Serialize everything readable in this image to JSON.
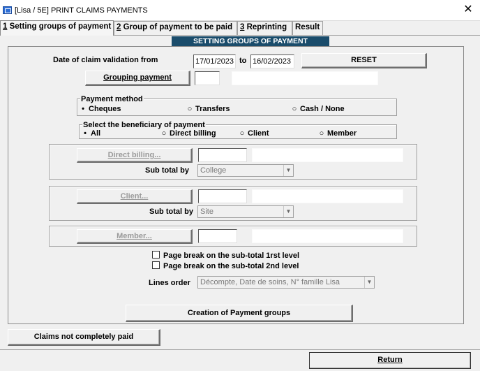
{
  "window": {
    "title": "[Lisa / 5E] PRINT CLAIMS PAYMENTS",
    "close": "✕"
  },
  "tabs": [
    {
      "num": "1",
      "label": " Setting groups of payment"
    },
    {
      "num": "2",
      "label": " Group of payment to be paid"
    },
    {
      "num": "3",
      "label": " Reprinting"
    },
    {
      "num": "",
      "label": "Result"
    }
  ],
  "section_header": "SETTING GROUPS OF PAYMENT",
  "date_range": {
    "label": "Date of claim validation from",
    "from": "17/01/2023",
    "to_label": "to",
    "to": "16/02/2023",
    "reset_label": "RESET"
  },
  "grouping_payment": {
    "button": "Grouping payment",
    "code": "",
    "desc": ""
  },
  "payment_method": {
    "title": "Payment method",
    "options": [
      "Cheques",
      "Transfers",
      "Cash / None"
    ],
    "selected": "Cheques"
  },
  "beneficiary": {
    "title": "Select the beneficiary of payment",
    "options": [
      "All",
      "Direct billing",
      "Client",
      "Member"
    ],
    "selected": "All"
  },
  "direct_billing": {
    "button": "Direct billing...",
    "subtotal_label": "Sub total by",
    "subtotal_value": "College"
  },
  "client": {
    "button": "Client...",
    "subtotal_label": "Sub total by",
    "subtotal_value": "Site"
  },
  "member": {
    "button": "Member..."
  },
  "checkboxes": [
    "Page break on the sub-total 1rst level",
    "Page break on the sub-total 2nd level"
  ],
  "lines_order": {
    "label": "Lines order",
    "value": "Décompte, Date de soins, N° famille Lisa"
  },
  "creation_button": "Creation of Payment groups",
  "claims_button": "Claims not completely paid",
  "return_button": "Return"
}
